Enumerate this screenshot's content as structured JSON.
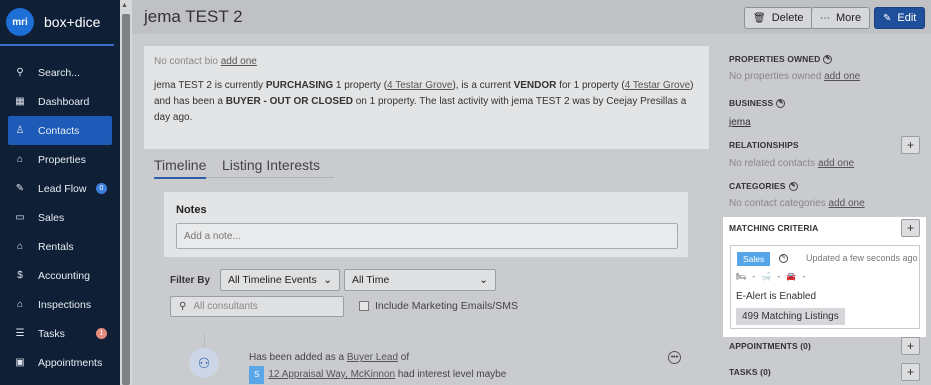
{
  "app": {
    "logo_text": "mri",
    "brand": "box+dice"
  },
  "sidebar": {
    "items": [
      {
        "label": "Search...",
        "icon": "search-icon",
        "glyph": "⚲"
      },
      {
        "label": "Dashboard",
        "icon": "grid-icon",
        "glyph": "▦"
      },
      {
        "label": "Contacts",
        "icon": "person-icon",
        "glyph": "♙",
        "active": true
      },
      {
        "label": "Properties",
        "icon": "home-icon",
        "glyph": "⌂"
      },
      {
        "label": "Lead Flow",
        "icon": "megaphone-icon",
        "glyph": "✎",
        "badge": "0"
      },
      {
        "label": "Sales",
        "icon": "sign-icon",
        "glyph": "▭"
      },
      {
        "label": "Rentals",
        "icon": "house-key-icon",
        "glyph": "⌂"
      },
      {
        "label": "Accounting",
        "icon": "dollar-icon",
        "glyph": "$"
      },
      {
        "label": "Inspections",
        "icon": "inspection-icon",
        "glyph": "⌂"
      },
      {
        "label": "Tasks",
        "icon": "checklist-icon",
        "glyph": "☰",
        "badge": "1"
      },
      {
        "label": "Appointments",
        "icon": "calendar-icon",
        "glyph": "▣"
      }
    ]
  },
  "header": {
    "title": "jema TEST 2",
    "delete_label": "Delete",
    "more_label": "More",
    "edit_label": "Edit"
  },
  "bio": {
    "no_bio_prefix": "No contact bio",
    "add_one": "add one",
    "s1": "jema TEST 2 is currently ",
    "s2": "PURCHASING",
    "s3": " 1 property (",
    "s4": "4 Testar Grove",
    "s5": "), is a current ",
    "s6": "VENDOR",
    "s7": " for 1 property (",
    "s8": "4 Testar Grove",
    "s9": ") and has been a ",
    "s10": "BUYER - OUT OR CLOSED",
    "s11": " on 1 property. The last activity with jema TEST 2 was by Ceejay Presillas a day ago."
  },
  "tabs": [
    {
      "label": "Timeline",
      "active": true
    },
    {
      "label": "Listing Interests",
      "active": false
    }
  ],
  "notes": {
    "title": "Notes",
    "placeholder": "Add a note..."
  },
  "filters": {
    "label": "Filter By",
    "events": "All Timeline Events",
    "time": "All Time",
    "consultants_placeholder": "All consultants",
    "marketing_label": "Include Marketing Emails/SMS"
  },
  "timeline": {
    "entry_prefix": "Has been added as a ",
    "entry_link": "Buyer Lead",
    "entry_of": " of",
    "tag": "S",
    "property_link": "12 Appraisal Way, McKinnon",
    "suffix": " had interest level maybe"
  },
  "right": {
    "properties_owned": "PROPERTIES OWNED",
    "no_properties": "No properties owned",
    "add_one": "add one",
    "business": "BUSINESS",
    "business_value": "jema",
    "relationships": "RELATIONSHIPS",
    "no_related": "No related contacts",
    "categories": "CATEGORIES",
    "no_categories": "No contact categories",
    "matching": "MATCHING CRITERIA",
    "sales_tag": "Sales",
    "updated": "Updated a few seconds ago",
    "icons_row": "🛏 -  🛁 -  🚘 -",
    "ealert": "E-Alert is Enabled",
    "matching_listings": "499 Matching Listings",
    "appointments": "APPOINTMENTS (0)",
    "tasks": "TASKS (0)"
  }
}
